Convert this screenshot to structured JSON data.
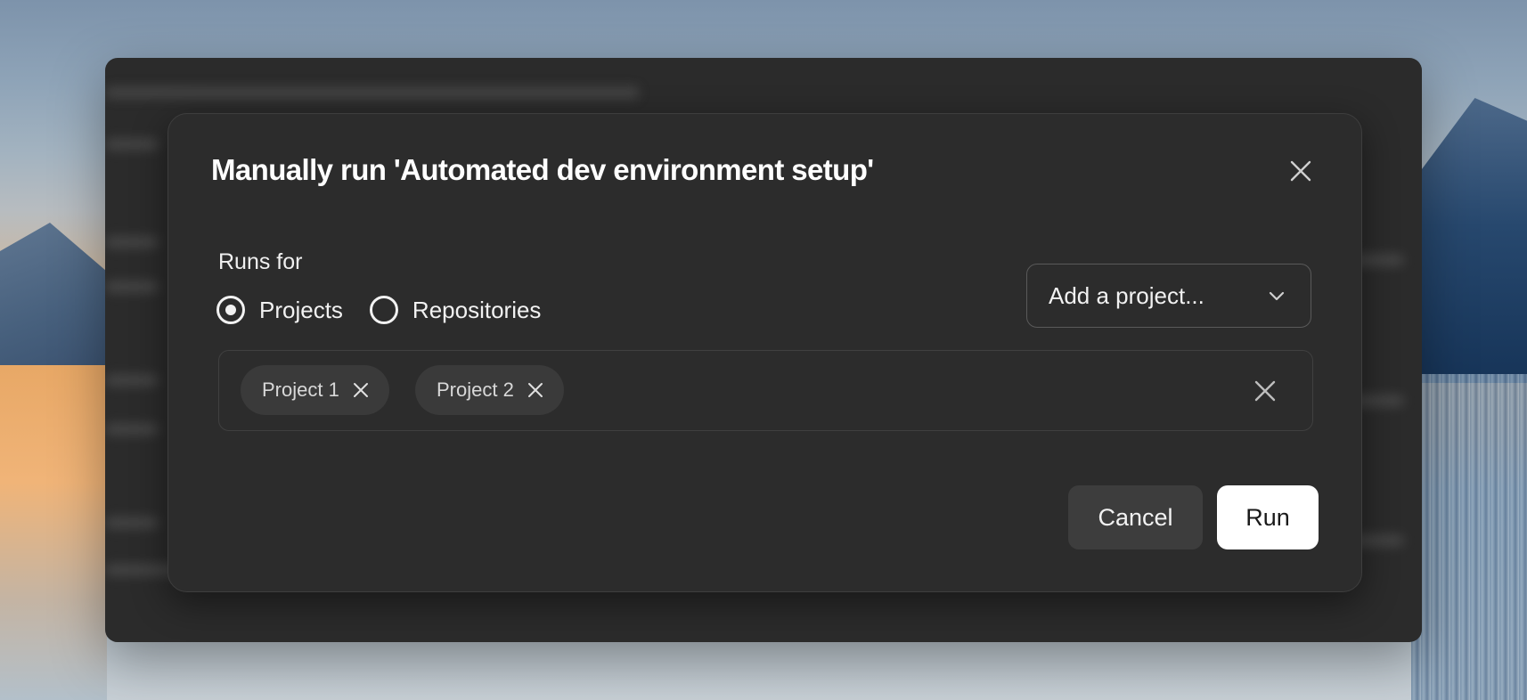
{
  "dialog": {
    "title": "Manually run 'Automated dev environment setup'",
    "runs_for_label": "Runs for",
    "radio_options": [
      {
        "label": "Projects",
        "selected": true
      },
      {
        "label": "Repositories",
        "selected": false
      }
    ],
    "project_select": {
      "placeholder": "Add a project..."
    },
    "selected_projects": [
      "Project 1",
      "Project 2"
    ],
    "cancel_label": "Cancel",
    "run_label": "Run"
  },
  "icons": {
    "close": "close-icon",
    "chevron": "chevron-down-icon",
    "chip_remove": "x-icon",
    "clear_all": "clear-icon"
  }
}
